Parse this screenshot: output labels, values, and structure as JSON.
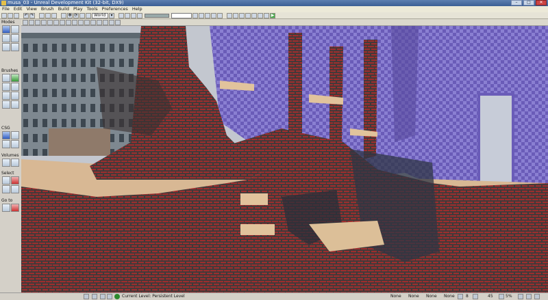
{
  "window": {
    "title": "musa_03 - Unreal Development Kit (32-bit, DX9)"
  },
  "menu": [
    "File",
    "Edit",
    "View",
    "Brush",
    "Build",
    "Play",
    "Tools",
    "Preferences",
    "Help"
  ],
  "toolbar": {
    "coord_system": "World",
    "search": ""
  },
  "leftpanel": {
    "modes": "Modes",
    "brushes": "Brushes",
    "csg": "CSG",
    "volumes": "Volumes",
    "select": "Select",
    "goto": "Go to"
  },
  "status": {
    "current_level": "Current Level:  Persistent Level",
    "cells": [
      "None",
      "None",
      "None",
      "None"
    ],
    "grid": "8",
    "rotation": "45",
    "scale": "5%"
  },
  "colors": {
    "titlebar": "#3a5e94",
    "checker_purple": "#7a6bc4",
    "tile_red": "#8b2a2a",
    "sand": "#d8b894"
  }
}
